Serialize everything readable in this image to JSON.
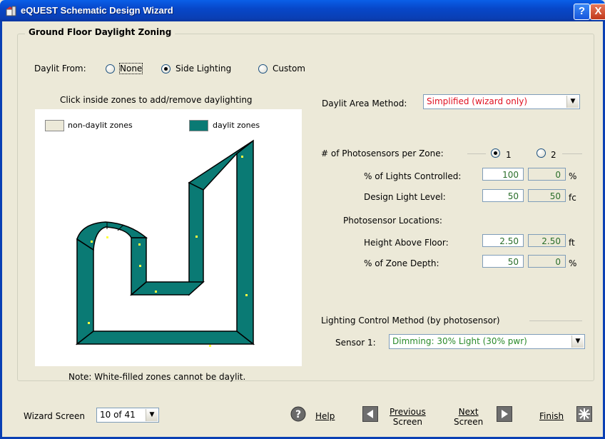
{
  "window": {
    "title": "eQUEST Schematic Design Wizard",
    "help_button": "?",
    "close_button": "X"
  },
  "group": {
    "title": "Ground Floor Daylight Zoning"
  },
  "daylit_from": {
    "label": "Daylit From:",
    "options": [
      {
        "label": "None",
        "selected": false
      },
      {
        "label": "Side Lighting",
        "selected": true
      },
      {
        "label": "Custom",
        "selected": false
      }
    ]
  },
  "plan": {
    "instruction": "Click inside zones to add/remove daylighting",
    "legend_non_daylit": "non-daylit zones",
    "legend_daylit": "daylit zones",
    "daylit_color": "#0a7a74",
    "note": "Note:  White-filled zones cannot be daylit."
  },
  "daylit_area": {
    "label": "Daylit Area Method:",
    "value": "Simplified (wizard only)",
    "value_color": "#e01020"
  },
  "photosensors": {
    "label": "# of Photosensors per Zone:",
    "option_1": "1",
    "option_2": "2",
    "selected": "1",
    "lights_controlled": {
      "label": "% of Lights Controlled:",
      "v1": "100",
      "v2": "0",
      "unit": "%"
    },
    "design_light": {
      "label": "Design Light Level:",
      "v1": "50",
      "v2": "50",
      "unit": "fc"
    },
    "locations_title": "Photosensor Locations:",
    "height": {
      "label": "Height Above Floor:",
      "v1": "2.50",
      "v2": "2.50",
      "unit": "ft"
    },
    "zone_depth": {
      "label": "% of Zone Depth:",
      "v1": "50",
      "v2": "0",
      "unit": "%"
    }
  },
  "control": {
    "title": "Lighting Control Method (by photosensor)",
    "sensor_label": "Sensor 1:",
    "sensor_value": "Dimming: 30% Light (30% pwr)",
    "value_color": "#2a8a2a"
  },
  "footer": {
    "wizard_screen_label": "Wizard Screen",
    "wizard_screen_value": "10 of 41",
    "help": "Help",
    "previous_1": "Previous",
    "previous_2": "Screen",
    "next_1": "Next",
    "next_2": "Screen",
    "finish": "Finish"
  }
}
